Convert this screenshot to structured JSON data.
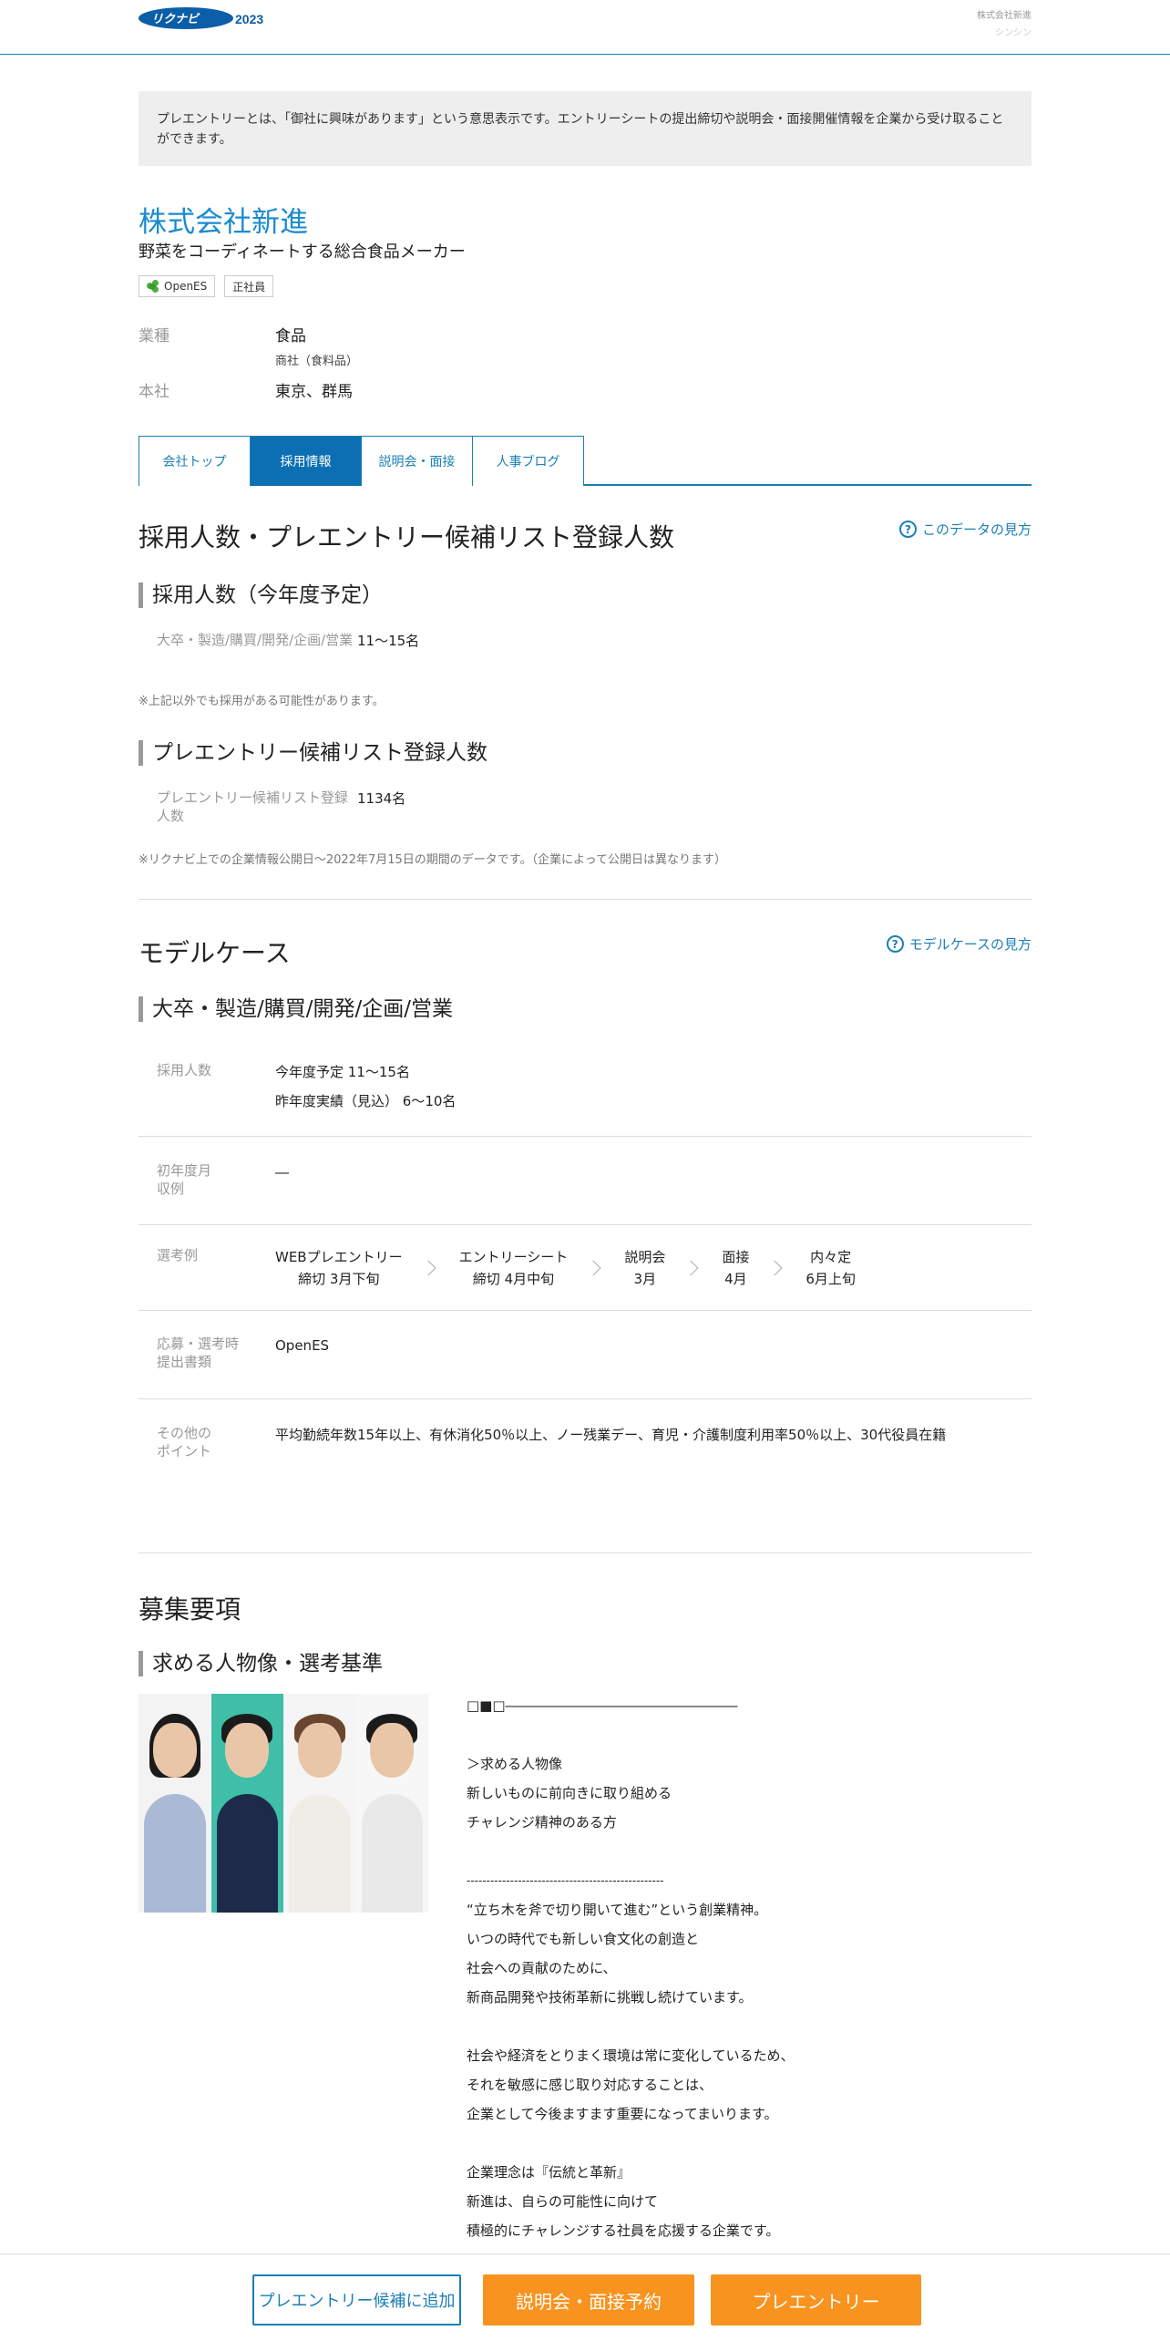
{
  "header": {
    "logo_text": "2023",
    "right_line1": "株式会社新進",
    "right_line2": "シンシン"
  },
  "notice": "プレエントリーとは、「御社に興味があります」という意思表示です。エントリーシートの提出締切や説明会・面接開催情報を企業から受け取ることができます。",
  "company": {
    "name": "株式会社新進",
    "description": "野菜をコーディネートする総合食品メーカー",
    "tags": [
      "OpenES",
      "正社員"
    ],
    "industry_label": "業種",
    "industry_value": "食品",
    "industry_sub": "商社（食料品）",
    "hq_label": "本社",
    "hq_value": "東京、群馬"
  },
  "tabs": [
    {
      "label": "会社トップ",
      "active": false
    },
    {
      "label": "採用情報",
      "active": true
    },
    {
      "label": "説明会・面接",
      "active": false
    },
    {
      "label": "人事ブログ",
      "active": false
    }
  ],
  "hiring": {
    "title": "採用人数・プレエントリー候補リスト登録人数",
    "help": "このデータの見方",
    "sub1_title": "採用人数（今年度予定）",
    "sub1_key": "大卒・製造/購買/開発/企画/営業",
    "sub1_value": "11～15名",
    "sub1_note": "※上記以外でも採用がある可能性があります。",
    "sub2_title": "プレエントリー候補リスト登録人数",
    "sub2_key": "プレエントリー候補リスト登録人数",
    "sub2_value": "1134名",
    "sub2_note": "※リクナビ上での企業情報公開日〜2022年7月15日の期間のデータです。（企業によって公開日は異なります）"
  },
  "model_case": {
    "title": "モデルケース",
    "help": "モデルケースの見方",
    "sub_title": "大卒・製造/購買/開発/企画/営業",
    "rows": {
      "hires_label": "採用人数",
      "hires_line1": "今年度予定 11～15名",
      "hires_line2": "昨年度実績（見込） 6～10名",
      "income_label": "初年度月収例",
      "income_value": "―",
      "selection_label": "選考例",
      "docs_label": "応募・選考時提出書類",
      "docs_value": "OpenES",
      "other_label": "その他のポイント",
      "other_value": "平均勤続年数15年以上、有休消化50％以上、ノー残業デー、育児・介護制度利用率50％以上、30代役員在籍"
    },
    "steps": [
      {
        "l1": "WEBプレエントリー",
        "l2": "締切 3月下旬"
      },
      {
        "l1": "エントリーシート",
        "l2": "締切 4月中旬"
      },
      {
        "l1": "説明会",
        "l2": "3月"
      },
      {
        "l1": "面接",
        "l2": "4月"
      },
      {
        "l1": "内々定",
        "l2": "6月上旬"
      }
    ]
  },
  "recruit": {
    "title": "募集要項",
    "sub_title": "求める人物像・選考基準",
    "lines": [
      "□■□―――――――――――――――――",
      "",
      "＞求める人物像",
      "新しいものに前向きに取り組める",
      "チャレンジ精神のある方",
      "",
      "--------------------------------------------------",
      "“立ち木を斧で切り開いて進む”という創業精神。",
      "いつの時代でも新しい食文化の創造と",
      "社会への貢献のために、",
      "新商品開発や技術革新に挑戦し続けています。",
      "",
      "社会や経済をとりまく環境は常に変化しているため、",
      "それを敏感に感じ取り対応することは、",
      "企業として今後ますます重要になってまいります。",
      "",
      "企業理念は『伝統と革新』",
      "新進は、自らの可能性に向けて",
      "積極的にチャレンジする社員を応援する企業です。"
    ]
  },
  "bottom_bar": {
    "add_candidate": "プレエントリー候補に追加",
    "reserve": "説明会・面接予約",
    "preentry": "プレエントリー"
  },
  "colors": {
    "accent": "#1a7fb5",
    "company_name": "#1a8bd0",
    "orange": "#f7931e"
  }
}
